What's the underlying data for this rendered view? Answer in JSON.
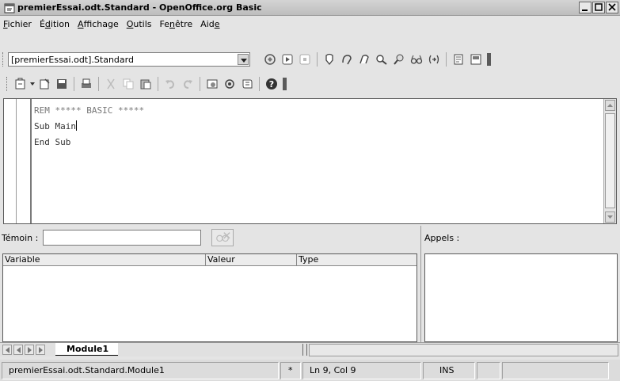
{
  "window": {
    "title": "premierEssai.odt.Standard - OpenOffice.org Basic"
  },
  "menubar": {
    "items": [
      {
        "label": "Fichier",
        "accel": "F"
      },
      {
        "label": "Édition",
        "accel": "d"
      },
      {
        "label": "Affichage",
        "accel": "A"
      },
      {
        "label": "Outils",
        "accel": "O"
      },
      {
        "label": "Fenêtre",
        "accel": "n"
      },
      {
        "label": "Aide",
        "accel": "e"
      }
    ]
  },
  "toolbar1": {
    "library_select": "[premierEssai.odt].Standard",
    "icons": [
      "compile-icon",
      "run-icon",
      "stop-icon",
      "step-into-icon",
      "step-over-icon",
      "step-out-icon",
      "breakpoint-icon",
      "manage-breakpoints-icon",
      "add-watch-icon",
      "find-parentheses-icon",
      "insert-source-icon",
      "save-source-icon"
    ]
  },
  "toolbar2": {
    "icons": [
      "insert-icon",
      "new-icon",
      "save-icon",
      "print-icon",
      "cut-icon",
      "copy-icon",
      "paste-icon",
      "undo-icon",
      "redo-icon",
      "object-catalog-icon",
      "macros-icon",
      "modules-icon",
      "help-icon"
    ]
  },
  "editor": {
    "lines": [
      "REM  *****  BASIC  *****",
      "Sub Main",
      "End Sub"
    ]
  },
  "watch": {
    "label": "Témoin :",
    "columns": [
      "Variable",
      "Valeur",
      "Type"
    ]
  },
  "calls": {
    "label": "Appels :"
  },
  "tabs": {
    "active": "Module1"
  },
  "statusbar": {
    "module": "premierEssai.odt.Standard.Module1",
    "modified": "*",
    "position": "Ln 9, Col 9",
    "mode": "INS"
  }
}
